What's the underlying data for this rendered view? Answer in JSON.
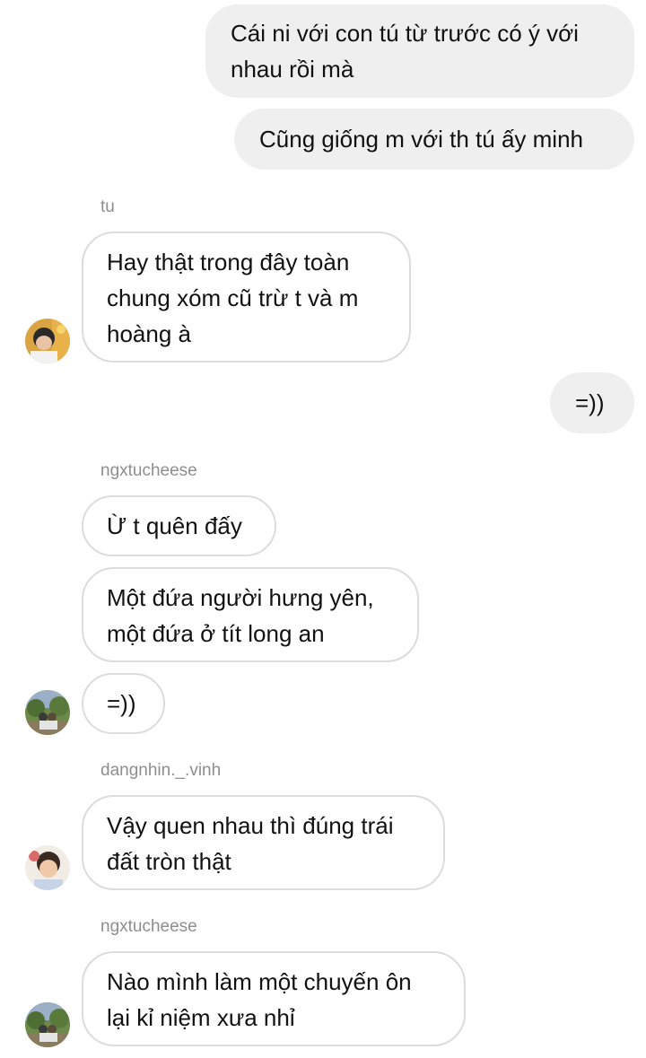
{
  "messages": {
    "m1": "Cái ni với con tú từ trước có ý với\nnhau rồi mà",
    "m2": "Cũng giống m với th tú ấy minh",
    "tu_name": "tu",
    "m3": "Hay thật trong đây toàn\nchung xóm cũ trừ t và m\nhoàng à",
    "m4": "=))",
    "ngx_name_1": "ngxtucheese",
    "m5": "Ừ t quên đấy",
    "m6": "Một đứa người hưng yên,\nmột đứa ở tít long an",
    "m7": "=))",
    "dang_name": "dangnhin._.vinh",
    "m8": "Vậy quen nhau thì đúng trái\nđất tròn thật",
    "ngx_name_2": "ngxtucheese",
    "m9": "Nào mình làm một chuyến ôn\nlại kỉ niệm xưa nhỉ"
  },
  "colors": {
    "outgoing_bubble": "#efefef",
    "incoming_border": "#dcdcdc",
    "sender_name": "#8e8e8e"
  }
}
